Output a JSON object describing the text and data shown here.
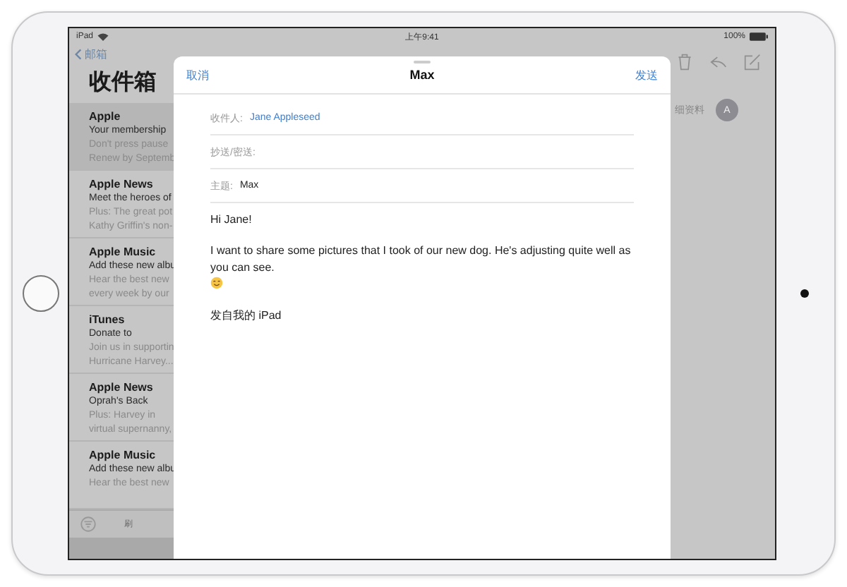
{
  "status_bar": {
    "device": "iPad",
    "time": "上午9:41",
    "battery": "100%"
  },
  "mailbox": {
    "back": "邮箱",
    "title": "收件箱",
    "messages": [
      {
        "sender": "Apple",
        "subject": "Your membership",
        "preview": [
          "Don't press pause",
          "Renew by Septemb"
        ],
        "selected": true
      },
      {
        "sender": "Apple News",
        "subject": "Meet the heroes of",
        "preview": [
          "Plus: The great pot",
          "Kathy Griffin's non-"
        ],
        "selected": false
      },
      {
        "sender": "Apple Music",
        "subject": "Add these new albu",
        "preview": [
          "Hear the best new",
          "every week by our"
        ],
        "selected": false
      },
      {
        "sender": "iTunes",
        "subject": "Donate to",
        "preview": [
          "Join us in supportin",
          "Hurricane Harvey..."
        ],
        "selected": false
      },
      {
        "sender": "Apple News",
        "subject": "Oprah's Back",
        "preview": [
          "Plus: Harvey in",
          "virtual supernanny,"
        ],
        "selected": false
      },
      {
        "sender": "Apple Music",
        "subject": "Add these new albu",
        "preview": [
          "Hear the best new"
        ],
        "selected": false
      }
    ],
    "toolbar_text": "刷"
  },
  "detail": {
    "details_link": "细资料",
    "avatar": "A"
  },
  "compose": {
    "cancel": "取消",
    "title": "Max",
    "send": "发送",
    "fields": [
      {
        "kind": "recipient",
        "label": "收件人:",
        "value": "Jane Appleseed"
      },
      {
        "kind": "text",
        "label": "抄送/密送:"
      },
      {
        "kind": "text",
        "label": "主题:",
        "value": "Max"
      }
    ],
    "body": [
      {
        "kind": "text",
        "text": "Hi Jane!"
      },
      {
        "kind": "text_emoji",
        "text": "I want to share some pictures that I took of our new dog. He's adjusting quite well as you can see."
      },
      {
        "kind": "text",
        "text": "发自我的 iPad"
      }
    ]
  }
}
